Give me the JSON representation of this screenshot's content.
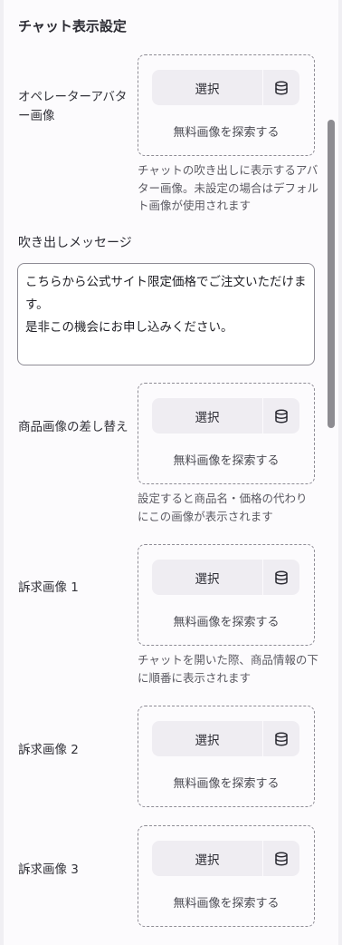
{
  "section_title": "チャット表示設定",
  "uploader_common": {
    "select_label": "選択",
    "free_images_label": "無料画像を探索する",
    "library_icon": "database-icon"
  },
  "operator_avatar": {
    "label": "オペレーターアバター画像",
    "help": "チャットの吹き出しに表示するアバター画像。未設定の場合はデフォルト画像が使用されます"
  },
  "bubble_message": {
    "label": "吹き出しメッセージ",
    "value": "こちらから公式サイト限定価格でご注文いただけます。\n是非この機会にお申し込みください。"
  },
  "product_image": {
    "label": "商品画像の差し替え",
    "help": "設定すると商品名・価格の代わりにこの画像が表示されます"
  },
  "appeal_image_1": {
    "label": "訴求画像 1",
    "help": "チャットを開いた際、商品情報の下に順番に表示されます"
  },
  "appeal_image_2": {
    "label": "訴求画像 2"
  },
  "appeal_image_3": {
    "label": "訴求画像 3"
  }
}
